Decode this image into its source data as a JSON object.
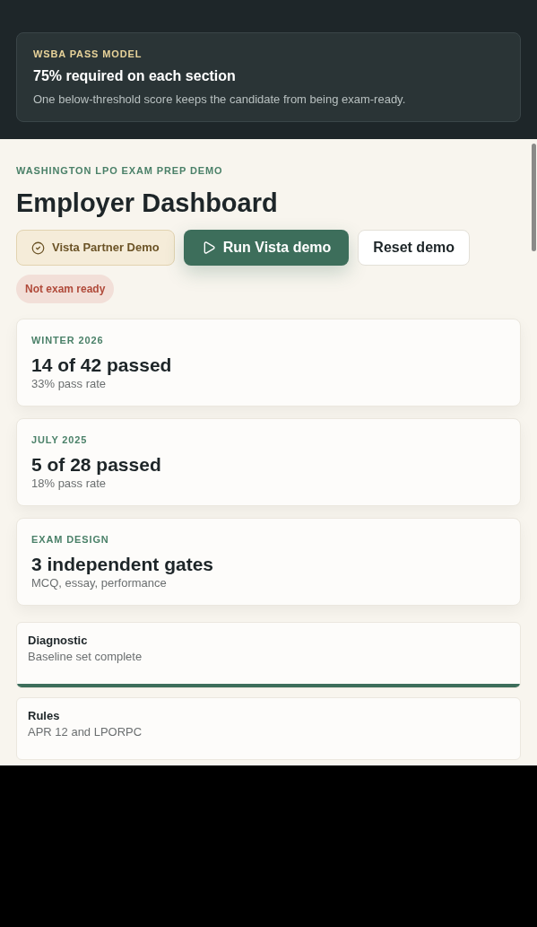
{
  "notice": {
    "eyebrow": "WSBA PASS MODEL",
    "title": "75% required on each section",
    "text": "One below-threshold score keeps the candidate from being exam-ready."
  },
  "header": {
    "eyebrow": "WASHINGTON LPO EXAM PREP DEMO",
    "title": "Employer Dashboard"
  },
  "actions": [
    {
      "kind": "badge",
      "label": "Vista Partner Demo"
    },
    {
      "kind": "primary",
      "label": "Run Vista demo"
    },
    {
      "kind": "secondary",
      "label": "Reset demo"
    }
  ],
  "status": {
    "label": "Not exam ready",
    "ready": false
  },
  "stats": [
    {
      "eyebrow": "WINTER 2026",
      "value": "14 of 42 passed",
      "note": "33% pass rate"
    },
    {
      "eyebrow": "JULY 2025",
      "value": "5 of 28 passed",
      "note": "18% pass rate"
    },
    {
      "eyebrow": "EXAM DESIGN",
      "value": "3 independent gates",
      "note": "MCQ, essay, performance"
    }
  ],
  "modules": [
    {
      "title": "Diagnostic",
      "text": "Baseline set complete",
      "level": 1
    },
    {
      "title": "Rules",
      "text": "APR 12 and LPORPC"
    }
  ]
}
